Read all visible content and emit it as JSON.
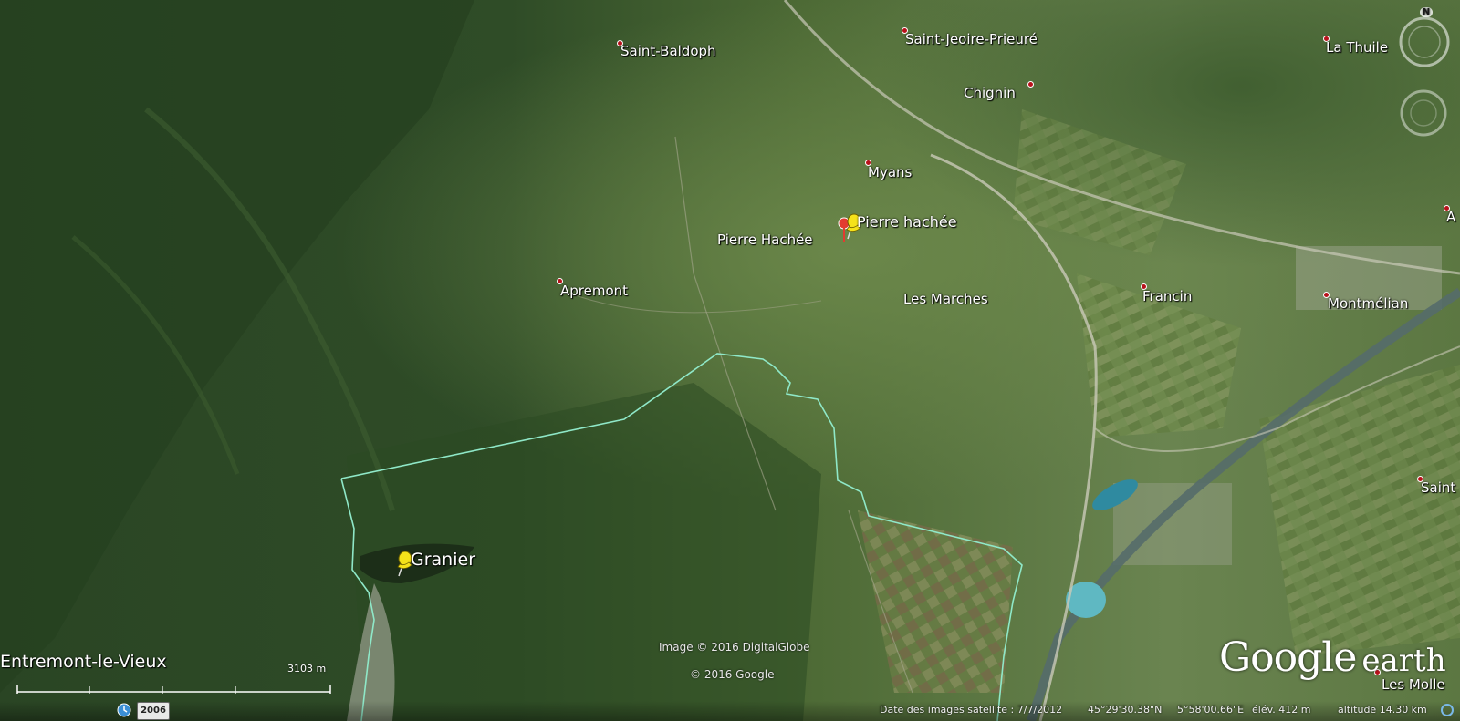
{
  "places": [
    {
      "name": "Saint-Baldoph",
      "id": "saint-baldoph"
    },
    {
      "name": "Saint-Jeoire-Prieuré",
      "id": "saint-jeoire-prieure"
    },
    {
      "name": "Chignin",
      "id": "chignin"
    },
    {
      "name": "La Thuile",
      "id": "la-thuile"
    },
    {
      "name": "Myans",
      "id": "myans"
    },
    {
      "name": "Pierre Hachée",
      "id": "pierre-hachee"
    },
    {
      "name": "Apremont",
      "id": "apremont"
    },
    {
      "name": "Les Marches",
      "id": "les-marches"
    },
    {
      "name": "Francin",
      "id": "francin"
    },
    {
      "name": "Montmélian",
      "id": "montmelian"
    },
    {
      "name": "Saint",
      "id": "saint-partial"
    },
    {
      "name": "A",
      "id": "a-partial"
    },
    {
      "name": "Les Molle",
      "id": "les-molle"
    }
  ],
  "placemarks": {
    "pierre_hachee": "Pierre hachée",
    "granier": "Granier"
  },
  "scale": {
    "location_label": "Entremont-le-Vieux",
    "distance": "3103  m"
  },
  "attribution": {
    "imagery": "Image © 2016 DigitalGlobe",
    "google": "© 2016 Google"
  },
  "logo": {
    "google": "Google",
    "earth": "earth"
  },
  "history": {
    "year": "2006"
  },
  "status": {
    "imagery_date": "Date des images satellite : 7/7/2012",
    "latitude": "45°29'30.38\"N",
    "longitude": "5°58'00.66\"E",
    "elevation": "élév.  412 m",
    "altitude": "altitude  14.30 km"
  },
  "compass": {
    "north": "N"
  },
  "colors": {
    "forest": "#2e4a26",
    "valley": "#5e7a3e",
    "boundary": "#8fe8c8",
    "place_dot": "#b8121b",
    "pushpin": "#f5e21a"
  }
}
